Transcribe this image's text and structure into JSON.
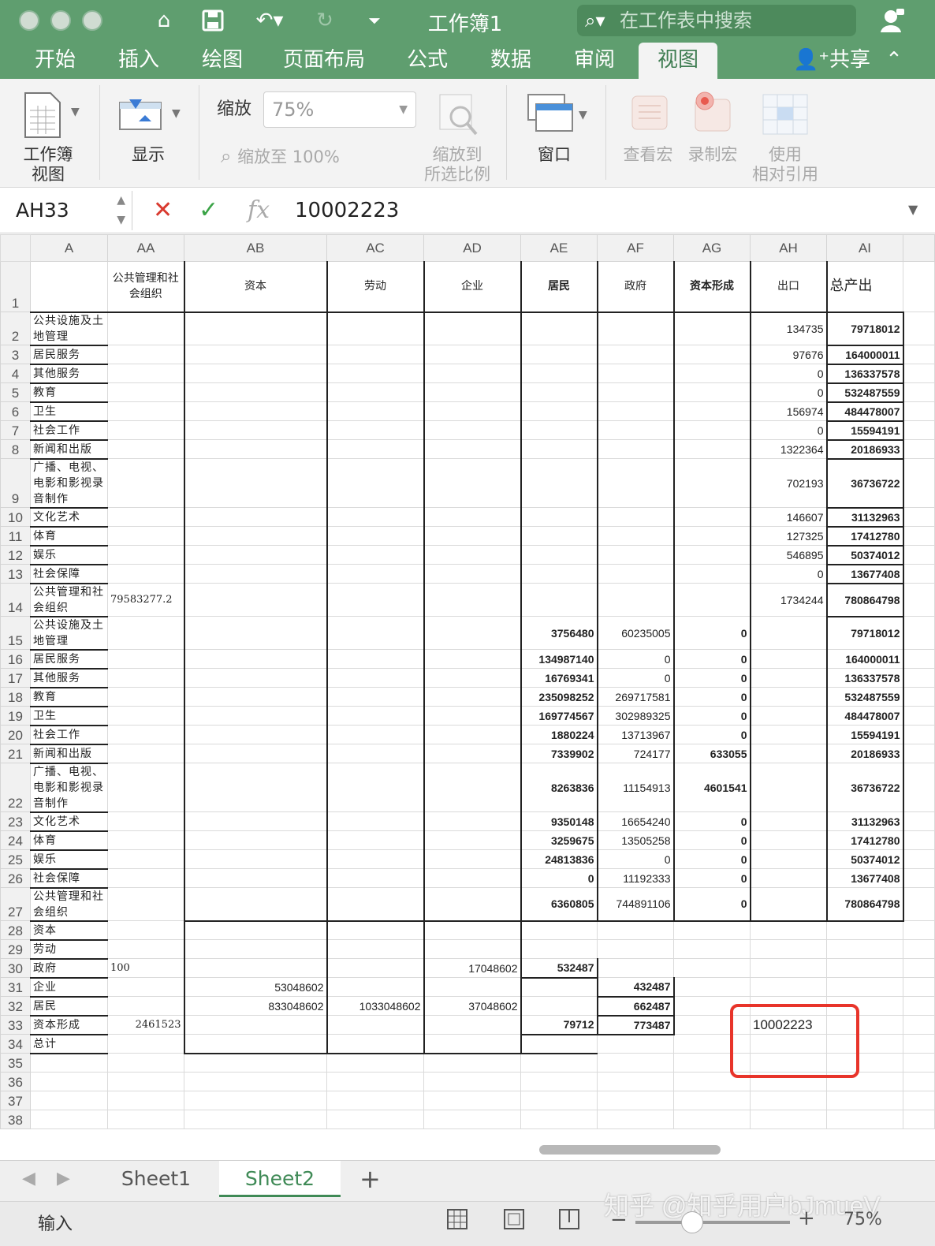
{
  "titlebar": {
    "title": "工作簿1",
    "search_placeholder": "在工作表中搜索"
  },
  "tabs": [
    "开始",
    "插入",
    "绘图",
    "页面布局",
    "公式",
    "数据",
    "审阅",
    "视图"
  ],
  "active_tab": "视图",
  "share_label": "共享",
  "ribbon": {
    "workbook_view": "工作簿\n视图",
    "show": "显示",
    "zoom_label": "缩放",
    "zoom_value": "75%",
    "zoom_100": "缩放至 100%",
    "zoom_selection": "缩放到\n所选比例",
    "window": "窗口",
    "view_macros": "查看宏",
    "record_macro": "录制宏",
    "relative_ref": "使用\n相对引用"
  },
  "formula_bar": {
    "name_box": "AH33",
    "value": "10002223"
  },
  "columns": [
    "A",
    "AA",
    "AB",
    "AC",
    "AD",
    "AE",
    "AF",
    "AG",
    "AH",
    "AI"
  ],
  "header_row": {
    "AA": "公共管理和社会组织",
    "AB": "资本",
    "AC": "劳动",
    "AD": "企业",
    "AE": "居民",
    "AF": "政府",
    "AG": "资本形成",
    "AH": "出口",
    "AI": "总产出"
  },
  "rows": [
    {
      "n": "2",
      "A": "公共设施及土地管理",
      "AH": "134735",
      "AI": "79718012"
    },
    {
      "n": "3",
      "A": "居民服务",
      "AH": "97676",
      "AI": "164000011"
    },
    {
      "n": "4",
      "A": "其他服务",
      "AH": "0",
      "AI": "136337578"
    },
    {
      "n": "5",
      "A": "教育",
      "AH": "0",
      "AI": "532487559"
    },
    {
      "n": "6",
      "A": "卫生",
      "AH": "156974",
      "AI": "484478007"
    },
    {
      "n": "7",
      "A": "社会工作",
      "AH": "0",
      "AI": "15594191"
    },
    {
      "n": "8",
      "A": "新闻和出版",
      "AH": "1322364",
      "AI": "20186933"
    },
    {
      "n": "9",
      "A": "广播、电视、电影和影视录音制作",
      "AH": "702193",
      "AI": "36736722"
    },
    {
      "n": "10",
      "A": "文化艺术",
      "AH": "146607",
      "AI": "31132963"
    },
    {
      "n": "11",
      "A": "体育",
      "AH": "127325",
      "AI": "17412780"
    },
    {
      "n": "12",
      "A": "娱乐",
      "AH": "546895",
      "AI": "50374012"
    },
    {
      "n": "13",
      "A": "社会保障",
      "AH": "0",
      "AI": "13677408"
    },
    {
      "n": "14",
      "A": "公共管理和社会组织",
      "AA": "79583277.2",
      "AH": "1734244",
      "AI": "780864798"
    },
    {
      "n": "15",
      "A": "公共设施及土地管理",
      "AE": "3756480",
      "AF": "60235005",
      "AG": "0",
      "AI": "79718012"
    },
    {
      "n": "16",
      "A": "居民服务",
      "AE": "134987140",
      "AF": "0",
      "AG": "0",
      "AI": "164000011"
    },
    {
      "n": "17",
      "A": "其他服务",
      "AE": "16769341",
      "AF": "0",
      "AG": "0",
      "AI": "136337578"
    },
    {
      "n": "18",
      "A": "教育",
      "AE": "235098252",
      "AF": "269717581",
      "AG": "0",
      "AI": "532487559"
    },
    {
      "n": "19",
      "A": "卫生",
      "AE": "169774567",
      "AF": "302989325",
      "AG": "0",
      "AI": "484478007"
    },
    {
      "n": "20",
      "A": "社会工作",
      "AE": "1880224",
      "AF": "13713967",
      "AG": "0",
      "AI": "15594191"
    },
    {
      "n": "21",
      "A": "新闻和出版",
      "AE": "7339902",
      "AF": "724177",
      "AG": "633055",
      "AI": "20186933"
    },
    {
      "n": "22",
      "A": "广播、电视、电影和影视录音制作",
      "AE": "8263836",
      "AF": "11154913",
      "AG": "4601541",
      "AI": "36736722"
    },
    {
      "n": "23",
      "A": "文化艺术",
      "AE": "9350148",
      "AF": "16654240",
      "AG": "0",
      "AI": "31132963"
    },
    {
      "n": "24",
      "A": "体育",
      "AE": "3259675",
      "AF": "13505258",
      "AG": "0",
      "AI": "17412780"
    },
    {
      "n": "25",
      "A": "娱乐",
      "AE": "24813836",
      "AF": "0",
      "AG": "0",
      "AI": "50374012"
    },
    {
      "n": "26",
      "A": "社会保障",
      "AE": "0",
      "AF": "11192333",
      "AG": "0",
      "AI": "13677408"
    },
    {
      "n": "27",
      "A": "公共管理和社会组织",
      "AE": "6360805",
      "AF": "744891106",
      "AG": "0",
      "AI": "780864798"
    },
    {
      "n": "28",
      "A": "资本"
    },
    {
      "n": "29",
      "A": "劳动"
    },
    {
      "n": "30",
      "A": "政府",
      "AA": "100",
      "AD": "17048602",
      "AE": "532487"
    },
    {
      "n": "31",
      "A": "企业",
      "AB": "53048602",
      "AF": "432487"
    },
    {
      "n": "32",
      "A": "居民",
      "AB": "833048602",
      "AC": "1033048602",
      "AD": "37048602",
      "AF": "662487"
    },
    {
      "n": "33",
      "A": "资本形成",
      "AA": "2461523",
      "AE": "79712",
      "AF": "773487",
      "AH": "10002223"
    },
    {
      "n": "34",
      "A": "总计"
    },
    {
      "n": "35"
    },
    {
      "n": "36"
    },
    {
      "n": "37"
    },
    {
      "n": "38"
    }
  ],
  "sheets": [
    "Sheet1",
    "Sheet2"
  ],
  "active_sheet": "Sheet2",
  "status": {
    "mode": "输入",
    "zoom": "75%"
  },
  "watermark": "知乎 @知乎用户bJmueV"
}
